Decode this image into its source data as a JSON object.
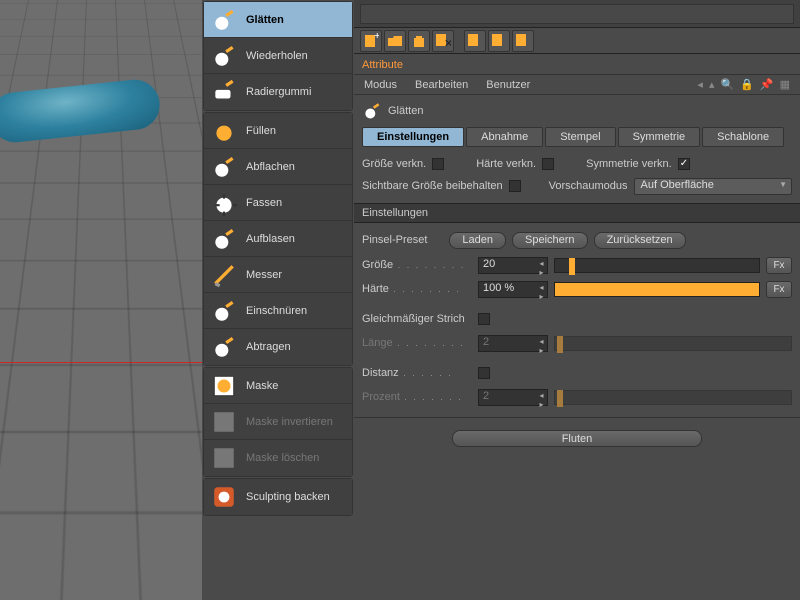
{
  "sidebar": {
    "groups": [
      {
        "items": [
          {
            "id": "glätten",
            "label": "Glätten",
            "selected": true
          },
          {
            "id": "wiederholen",
            "label": "Wiederholen"
          },
          {
            "id": "radiergummi",
            "label": "Radiergummi"
          }
        ]
      },
      {
        "items": [
          {
            "id": "füllen",
            "label": "Füllen"
          },
          {
            "id": "abflachen",
            "label": "Abflachen"
          },
          {
            "id": "fassen",
            "label": "Fassen"
          },
          {
            "id": "aufblasen",
            "label": "Aufblasen"
          },
          {
            "id": "messer",
            "label": "Messer"
          },
          {
            "id": "einschnüren",
            "label": "Einschnüren"
          },
          {
            "id": "abtragen",
            "label": "Abtragen"
          }
        ]
      },
      {
        "items": [
          {
            "id": "maske",
            "label": "Maske"
          },
          {
            "id": "maske-invertieren",
            "label": "Maske invertieren",
            "disabled": true
          },
          {
            "id": "maske-löschen",
            "label": "Maske löschen",
            "disabled": true
          }
        ]
      },
      {
        "items": [
          {
            "id": "sculpting-backen",
            "label": "Sculpting backen"
          }
        ]
      }
    ]
  },
  "attributes": {
    "panel_label": "Attribute",
    "menu": [
      "Modus",
      "Bearbeiten",
      "Benutzer"
    ],
    "brush_title": "Glätten",
    "tabs": [
      {
        "id": "einstellungen",
        "label": "Einstellungen",
        "active": true
      },
      {
        "id": "abnahme",
        "label": "Abnahme"
      },
      {
        "id": "stempel",
        "label": "Stempel"
      },
      {
        "id": "symmetrie",
        "label": "Symmetrie"
      },
      {
        "id": "schablone",
        "label": "Schablone"
      }
    ],
    "checks": {
      "groesse_verkn": {
        "label": "Größe verkn.",
        "value": false
      },
      "haerte_verkn": {
        "label": "Härte verkn.",
        "value": false
      },
      "symmetrie_verkn": {
        "label": "Symmetrie verkn.",
        "value": true
      },
      "sichtbare_groesse": {
        "label": "Sichtbare Größe beibehalten",
        "value": false
      }
    },
    "vorschau": {
      "label": "Vorschaumodus",
      "value": "Auf Oberfläche"
    },
    "section_einstellungen": "Einstellungen",
    "preset": {
      "label": "Pinsel-Preset",
      "load": "Laden",
      "save": "Speichern",
      "reset": "Zurücksetzen"
    },
    "groesse": {
      "label": "Größe",
      "value": "20",
      "pct": 7
    },
    "haerte": {
      "label": "Härte",
      "value": "100 %",
      "pct": 100
    },
    "gleichstrich": {
      "label": "Gleichmäßiger Strich",
      "value": false
    },
    "laenge": {
      "label": "Länge",
      "value": "2",
      "pct": 1,
      "disabled": true
    },
    "distanz": {
      "label": "Distanz",
      "value": false
    },
    "prozent": {
      "label": "Prozent",
      "value": "2",
      "pct": 1,
      "disabled": true
    },
    "fluten": "Fluten",
    "fx": "Fx"
  }
}
